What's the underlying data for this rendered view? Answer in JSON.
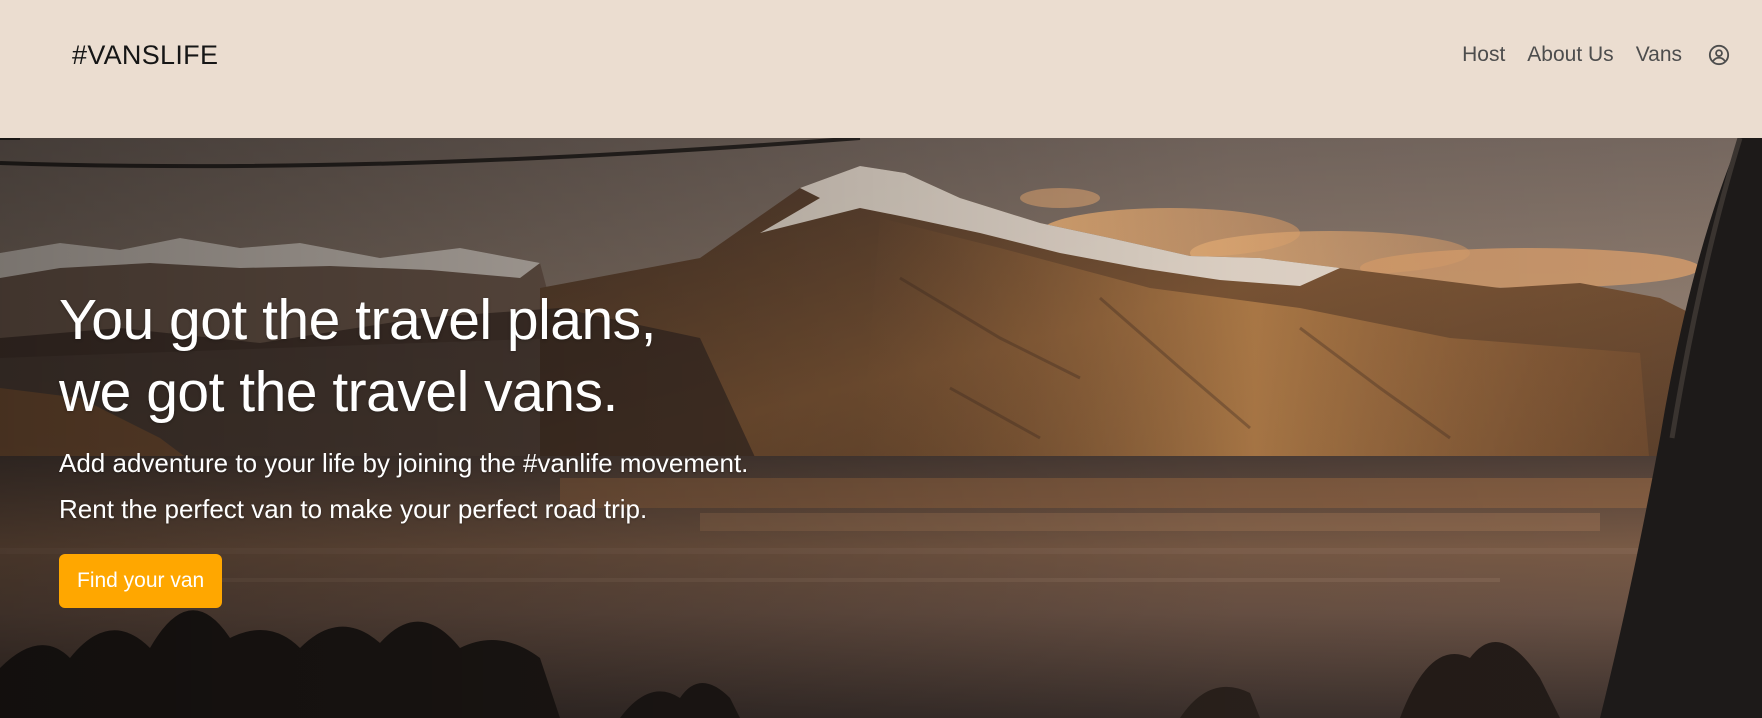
{
  "header": {
    "logo": "#VANSLIFE",
    "nav": [
      {
        "label": "Host"
      },
      {
        "label": "About Us"
      },
      {
        "label": "Vans"
      }
    ],
    "account_icon": "user-circle-icon"
  },
  "hero": {
    "title_line1": "You got the travel plans,",
    "title_line2": "we got the travel vans.",
    "subtitle_line1": "Add adventure to your life by joining the #vanlife movement.",
    "subtitle_line2": "Rent the perfect van to make your perfect road trip.",
    "cta_label": "Find your van",
    "background": "mountain-lake-sunset-photo"
  },
  "colors": {
    "header_bg": "#EBDDD0",
    "logo_text": "#161616",
    "nav_text": "#4D4D4D",
    "cta_bg": "#FFA700",
    "hero_text": "#FFFFFF"
  }
}
